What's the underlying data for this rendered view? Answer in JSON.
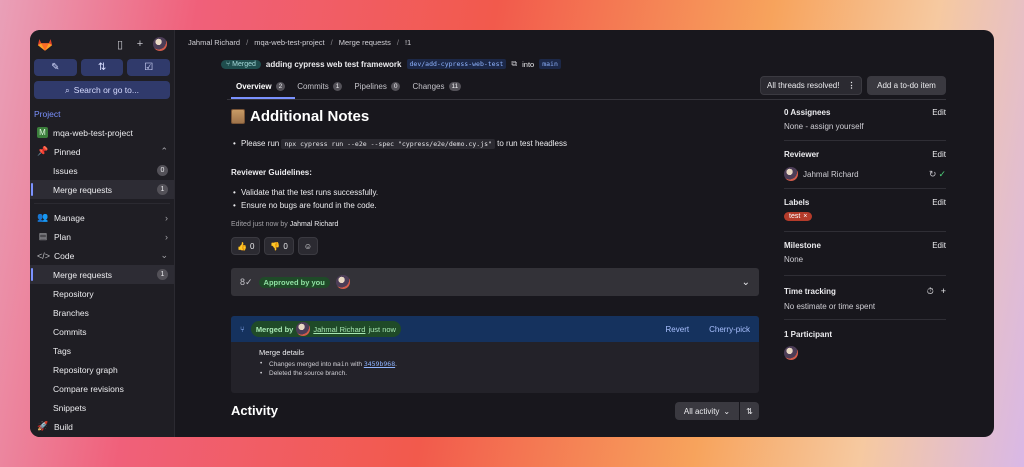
{
  "sidebar": {
    "search_label": "Search or go to...",
    "section_title": "Project",
    "project_initial": "M",
    "project_name": "mqa-web-test-project",
    "pinned_label": "Pinned",
    "pinned_items": [
      {
        "label": "Issues",
        "count": "0"
      },
      {
        "label": "Merge requests",
        "count": "1"
      }
    ],
    "manage_label": "Manage",
    "plan_label": "Plan",
    "code_label": "Code",
    "code_items": [
      {
        "label": "Merge requests",
        "count": "1"
      },
      {
        "label": "Repository"
      },
      {
        "label": "Branches"
      },
      {
        "label": "Commits"
      },
      {
        "label": "Tags"
      },
      {
        "label": "Repository graph"
      },
      {
        "label": "Compare revisions"
      },
      {
        "label": "Snippets"
      }
    ],
    "build_label": "Build"
  },
  "breadcrumb": [
    "Jahmal Richard",
    "mqa-web-test-project",
    "Merge requests",
    "!1"
  ],
  "mr": {
    "status": "Merged",
    "title": "adding cypress web test framework",
    "source_branch": "dev/add-cypress-web-test",
    "into_label": "into",
    "target_branch": "main"
  },
  "tabs": [
    {
      "label": "Overview",
      "count": "2"
    },
    {
      "label": "Commits",
      "count": "1"
    },
    {
      "label": "Pipelines",
      "count": "0"
    },
    {
      "label": "Changes",
      "count": "11"
    }
  ],
  "toolbar": {
    "threads_label": "All threads resolved!",
    "todo_label": "Add a to-do item"
  },
  "description": {
    "heading": "Additional Notes",
    "run_prefix": "Please run",
    "run_command": "npx cypress run --e2e --spec \"cypress/e2e/demo.cy.js\"",
    "run_suffix": "to run test headless",
    "guidelines_title": "Reviewer Guidelines:",
    "guidelines": [
      "Validate that the test runs successfully.",
      "Ensure no bugs are found in the code."
    ],
    "edited_prefix": "Edited just now by",
    "edited_by": "Jahmal Richard"
  },
  "reactions": {
    "thumbs_up": "0",
    "thumbs_down": "0"
  },
  "approval": {
    "label": "Approved by you"
  },
  "merge": {
    "merged_by_label": "Merged by",
    "merged_by": "Jahmal Richard",
    "merged_when": "just now",
    "revert_label": "Revert",
    "cherry_pick_label": "Cherry-pick",
    "details_title": "Merge details",
    "detail_prefix": "Changes merged into",
    "detail_branch": "main",
    "detail_with": "with",
    "detail_sha": "3459b968",
    "detail_deleted": "Deleted the source branch."
  },
  "activity": {
    "heading": "Activity",
    "filter_label": "All activity"
  },
  "right_panel": {
    "assignees_title": "0 Assignees",
    "assignees_value": "None - assign yourself",
    "reviewer_title": "Reviewer",
    "reviewer_name": "Jahmal Richard",
    "labels_title": "Labels",
    "label_value": "test",
    "milestone_title": "Milestone",
    "milestone_value": "None",
    "time_title": "Time tracking",
    "time_value": "No estimate or time spent",
    "participants_title": "1 Participant",
    "edit_label": "Edit"
  }
}
